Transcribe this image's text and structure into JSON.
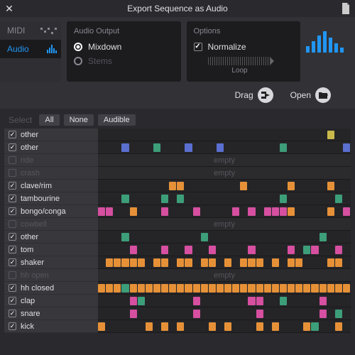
{
  "title": "Export Sequence as Audio",
  "sideTabs": {
    "midi": "MIDI",
    "audio": "Audio"
  },
  "output": {
    "heading": "Audio Output",
    "mixdown": "Mixdown",
    "stems": "Stems",
    "selected": "mixdown"
  },
  "options": {
    "heading": "Options",
    "normalize": "Normalize",
    "normalize_on": true,
    "loop_label": "Loop"
  },
  "actions": {
    "drag": "Drag",
    "open": "Open"
  },
  "select": {
    "label": "Select",
    "all": "All",
    "none": "None",
    "audible": "Audible"
  },
  "empty_text": "empty",
  "laneWidth": 356,
  "steps": 32,
  "colors": {
    "o": "#e69138",
    "p": "#d64fa0",
    "g": "#3d9e7a",
    "b": "#5b6fd0",
    "y": "#c9b94a"
  },
  "tracks": [
    {
      "name": "other",
      "on": true,
      "notes": [
        {
          "s": 29,
          "c": "y"
        }
      ]
    },
    {
      "name": "other",
      "on": true,
      "notes": [
        {
          "s": 3,
          "c": "b"
        },
        {
          "s": 7,
          "c": "g"
        },
        {
          "s": 11,
          "c": "b"
        },
        {
          "s": 15,
          "c": "b"
        },
        {
          "s": 23,
          "c": "g"
        },
        {
          "s": 31,
          "c": "b"
        }
      ]
    },
    {
      "name": "ride",
      "on": false,
      "notes": []
    },
    {
      "name": "crash",
      "on": false,
      "notes": []
    },
    {
      "name": "clave/rim",
      "on": true,
      "notes": [
        {
          "s": 9,
          "c": "o"
        },
        {
          "s": 10,
          "c": "o"
        },
        {
          "s": 18,
          "c": "o"
        },
        {
          "s": 24,
          "c": "o"
        },
        {
          "s": 29,
          "c": "o"
        }
      ]
    },
    {
      "name": "tambourine",
      "on": true,
      "notes": [
        {
          "s": 3,
          "c": "g"
        },
        {
          "s": 8,
          "c": "g"
        },
        {
          "s": 10,
          "c": "g"
        },
        {
          "s": 23,
          "c": "g"
        },
        {
          "s": 30,
          "c": "g"
        }
      ]
    },
    {
      "name": "bongo/conga",
      "on": true,
      "notes": [
        {
          "s": 0,
          "c": "p"
        },
        {
          "s": 1,
          "c": "p"
        },
        {
          "s": 4,
          "c": "o"
        },
        {
          "s": 8,
          "c": "p"
        },
        {
          "s": 12,
          "c": "p"
        },
        {
          "s": 17,
          "c": "p"
        },
        {
          "s": 19,
          "c": "p"
        },
        {
          "s": 21,
          "c": "p"
        },
        {
          "s": 22,
          "c": "p"
        },
        {
          "s": 23,
          "c": "p"
        },
        {
          "s": 24,
          "c": "o"
        },
        {
          "s": 29,
          "c": "o"
        },
        {
          "s": 31,
          "c": "p"
        }
      ]
    },
    {
      "name": "cowbell",
      "on": false,
      "notes": []
    },
    {
      "name": "other",
      "on": true,
      "notes": [
        {
          "s": 3,
          "c": "g"
        },
        {
          "s": 13,
          "c": "g"
        },
        {
          "s": 28,
          "c": "g"
        }
      ]
    },
    {
      "name": "tom",
      "on": true,
      "notes": [
        {
          "s": 4,
          "c": "p"
        },
        {
          "s": 8,
          "c": "p"
        },
        {
          "s": 11,
          "c": "p"
        },
        {
          "s": 14,
          "c": "p"
        },
        {
          "s": 19,
          "c": "p"
        },
        {
          "s": 24,
          "c": "p"
        },
        {
          "s": 26,
          "c": "g"
        },
        {
          "s": 27,
          "c": "p"
        },
        {
          "s": 30,
          "c": "p"
        }
      ]
    },
    {
      "name": "shaker",
      "on": true,
      "notes": [
        {
          "s": 1,
          "c": "o"
        },
        {
          "s": 2,
          "c": "o"
        },
        {
          "s": 3,
          "c": "o"
        },
        {
          "s": 4,
          "c": "o"
        },
        {
          "s": 5,
          "c": "o"
        },
        {
          "s": 7,
          "c": "o"
        },
        {
          "s": 8,
          "c": "o"
        },
        {
          "s": 10,
          "c": "o"
        },
        {
          "s": 11,
          "c": "o"
        },
        {
          "s": 13,
          "c": "o"
        },
        {
          "s": 14,
          "c": "o"
        },
        {
          "s": 16,
          "c": "o"
        },
        {
          "s": 18,
          "c": "o"
        },
        {
          "s": 19,
          "c": "o"
        },
        {
          "s": 20,
          "c": "o"
        },
        {
          "s": 22,
          "c": "o"
        },
        {
          "s": 24,
          "c": "o"
        },
        {
          "s": 25,
          "c": "o"
        },
        {
          "s": 29,
          "c": "o"
        },
        {
          "s": 30,
          "c": "o"
        }
      ]
    },
    {
      "name": "hh open",
      "on": false,
      "notes": []
    },
    {
      "name": "hh closed",
      "on": true,
      "notes": [
        {
          "s": 0,
          "c": "o"
        },
        {
          "s": 1,
          "c": "o"
        },
        {
          "s": 2,
          "c": "o"
        },
        {
          "s": 3,
          "c": "g"
        },
        {
          "s": 4,
          "c": "o"
        },
        {
          "s": 5,
          "c": "o"
        },
        {
          "s": 6,
          "c": "o"
        },
        {
          "s": 7,
          "c": "o"
        },
        {
          "s": 8,
          "c": "o"
        },
        {
          "s": 9,
          "c": "o"
        },
        {
          "s": 10,
          "c": "o"
        },
        {
          "s": 11,
          "c": "o"
        },
        {
          "s": 12,
          "c": "o"
        },
        {
          "s": 13,
          "c": "o"
        },
        {
          "s": 14,
          "c": "o"
        },
        {
          "s": 15,
          "c": "o"
        },
        {
          "s": 16,
          "c": "o"
        },
        {
          "s": 17,
          "c": "o"
        },
        {
          "s": 18,
          "c": "o"
        },
        {
          "s": 19,
          "c": "o"
        },
        {
          "s": 20,
          "c": "o"
        },
        {
          "s": 21,
          "c": "o"
        },
        {
          "s": 22,
          "c": "o"
        },
        {
          "s": 23,
          "c": "o"
        },
        {
          "s": 24,
          "c": "o"
        },
        {
          "s": 25,
          "c": "o"
        },
        {
          "s": 26,
          "c": "o"
        },
        {
          "s": 27,
          "c": "o"
        },
        {
          "s": 28,
          "c": "o"
        },
        {
          "s": 29,
          "c": "o"
        },
        {
          "s": 30,
          "c": "o"
        },
        {
          "s": 31,
          "c": "o"
        }
      ]
    },
    {
      "name": "clap",
      "on": true,
      "notes": [
        {
          "s": 4,
          "c": "p"
        },
        {
          "s": 5,
          "c": "g"
        },
        {
          "s": 12,
          "c": "p"
        },
        {
          "s": 19,
          "c": "p"
        },
        {
          "s": 20,
          "c": "p"
        },
        {
          "s": 23,
          "c": "g"
        },
        {
          "s": 28,
          "c": "p"
        }
      ]
    },
    {
      "name": "snare",
      "on": true,
      "notes": [
        {
          "s": 4,
          "c": "p"
        },
        {
          "s": 12,
          "c": "p"
        },
        {
          "s": 20,
          "c": "p"
        },
        {
          "s": 28,
          "c": "p"
        },
        {
          "s": 30,
          "c": "g"
        }
      ]
    },
    {
      "name": "kick",
      "on": true,
      "notes": [
        {
          "s": 0,
          "c": "o"
        },
        {
          "s": 6,
          "c": "o"
        },
        {
          "s": 8,
          "c": "o"
        },
        {
          "s": 10,
          "c": "o"
        },
        {
          "s": 14,
          "c": "o"
        },
        {
          "s": 16,
          "c": "o"
        },
        {
          "s": 20,
          "c": "o"
        },
        {
          "s": 22,
          "c": "o"
        },
        {
          "s": 26,
          "c": "o"
        },
        {
          "s": 27,
          "c": "g"
        },
        {
          "s": 30,
          "c": "o"
        }
      ]
    }
  ]
}
